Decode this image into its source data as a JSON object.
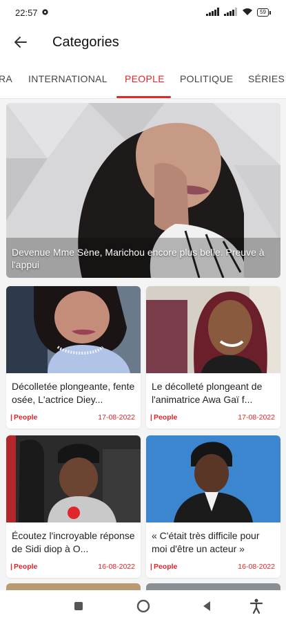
{
  "status_bar": {
    "time": "22:57",
    "battery": "59"
  },
  "app_bar": {
    "title": "Categories"
  },
  "tabs": [
    {
      "label": "RA"
    },
    {
      "label": "INTERNATIONAL"
    },
    {
      "label": "PEOPLE",
      "active": true
    },
    {
      "label": "POLITIQUE"
    },
    {
      "label": "SÉRIES E"
    }
  ],
  "hero": {
    "title": "Devenue Mme Sène, Marichou encore plus belle. Preuve à l'appui"
  },
  "cards": [
    {
      "title": "Décolletée plongeante, fente osée, L'actrice Diey...",
      "category": "People",
      "date": "17-08-2022"
    },
    {
      "title": "Le décolleté plongeant de l'animatrice Awa Gaï f...",
      "category": "People",
      "date": "17-08-2022"
    },
    {
      "title": "Écoutez l'incroyable réponse de Sidi diop à O...",
      "category": "People",
      "date": "16-08-2022"
    },
    {
      "title": "« C'était très difficile pour moi d'être un acteur »",
      "category": "People",
      "date": "16-08-2022"
    }
  ],
  "colors": {
    "accent": "#e0252b",
    "background": "#f4f4f4"
  }
}
